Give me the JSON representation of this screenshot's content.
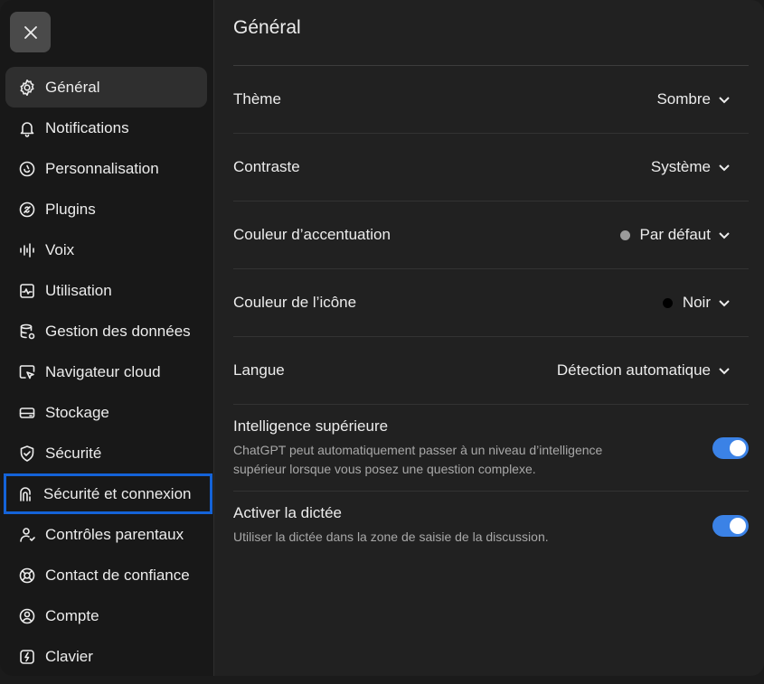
{
  "sidebar": {
    "close_icon": "close-icon",
    "items": [
      {
        "label": "Général",
        "icon": "gear-icon",
        "active": true
      },
      {
        "label": "Notifications",
        "icon": "bell-icon"
      },
      {
        "label": "Personnalisation",
        "icon": "personalize-icon"
      },
      {
        "label": "Plugins",
        "icon": "plugin-icon"
      },
      {
        "label": "Voix",
        "icon": "waveform-icon"
      },
      {
        "label": "Utilisation",
        "icon": "usage-icon"
      },
      {
        "label": "Gestion des données",
        "icon": "database-icon"
      },
      {
        "label": "Navigateur cloud",
        "icon": "cloud-browser-icon"
      },
      {
        "label": "Stockage",
        "icon": "storage-icon"
      },
      {
        "label": "Sécurité",
        "icon": "shield-icon"
      },
      {
        "label": "Sécurité et connexion",
        "icon": "security-login-icon",
        "highlighted": true
      },
      {
        "label": "Contrôles parentaux",
        "icon": "parental-controls-icon"
      },
      {
        "label": "Contact de confiance",
        "icon": "lifebuoy-icon"
      },
      {
        "label": "Compte",
        "icon": "account-icon"
      },
      {
        "label": "Clavier",
        "icon": "keyboard-icon"
      }
    ]
  },
  "main": {
    "title": "Général",
    "settings": [
      {
        "label": "Thème",
        "value": "Sombre"
      },
      {
        "label": "Contraste",
        "value": "Système"
      },
      {
        "label": "Couleur d’accentuation",
        "value": "Par défaut",
        "dot_color": "#9b9b9b"
      },
      {
        "label": "Couleur de l’icône",
        "value": "Noir",
        "dot_color": "#000000"
      },
      {
        "label": "Langue",
        "value": "Détection automatique"
      }
    ],
    "toggles": [
      {
        "label": "Intelligence supérieure",
        "description": "ChatGPT peut automatiquement passer à un niveau d’intelligence supérieur lorsque vous posez une question complexe.",
        "enabled": true
      },
      {
        "label": "Activer la dictée",
        "description": "Utiliser la dictée dans la zone de saisie de la discussion.",
        "enabled": true
      }
    ]
  },
  "colors": {
    "accent": "#3b82e6",
    "highlight_outline": "#1463d8",
    "background": "#212121",
    "sidebar": "#181818"
  }
}
